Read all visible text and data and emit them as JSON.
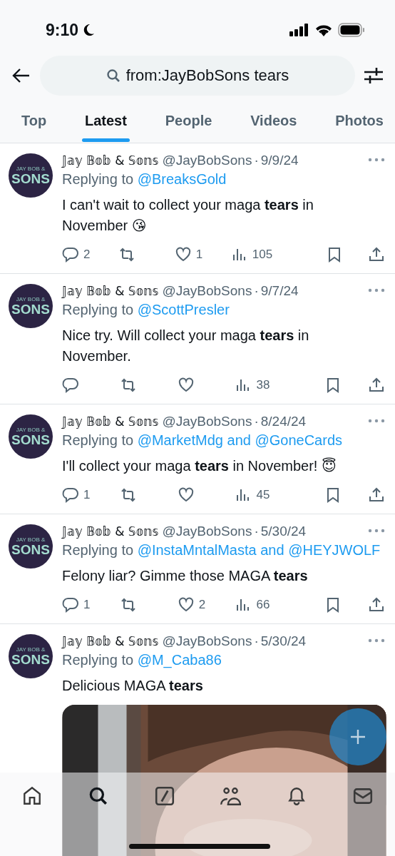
{
  "status_bar": {
    "time": "9:10"
  },
  "search": {
    "value": "from:JayBobSons tears"
  },
  "tabs": [
    {
      "label": "Top",
      "selected": false
    },
    {
      "label": "Latest",
      "selected": true
    },
    {
      "label": "People",
      "selected": false
    },
    {
      "label": "Videos",
      "selected": false
    },
    {
      "label": "Photos",
      "selected": false
    }
  ],
  "separator": "·",
  "tweets": [
    {
      "avatar": {
        "line_1": "JAY BOB &",
        "line_2": "SONS"
      },
      "name": "𝕁𝕒𝕪 𝔹𝕠𝕓 & 𝕊𝕠𝕟𝕤",
      "handle": "@JayBobSons",
      "date": "9/9/24",
      "replying_label": "Replying to",
      "replying_to": "@BreaksGold",
      "text": "I can't wait to collect your maga **tears** in November 😘",
      "actions": [
        {
          "kind": "reply",
          "count": "2"
        },
        {
          "kind": "retweet"
        },
        {
          "kind": "like",
          "count": "1"
        },
        {
          "kind": "views",
          "count": "105"
        },
        {
          "kind": "bookmark"
        },
        {
          "kind": "share"
        }
      ]
    },
    {
      "avatar": {
        "line_1": "JAY BOB &",
        "line_2": "SONS"
      },
      "name": "𝕁𝕒𝕪 𝔹𝕠𝕓 & 𝕊𝕠𝕟𝕤",
      "handle": "@JayBobSons",
      "date": "9/7/24",
      "replying_label": "Replying to",
      "replying_to": "@ScottPresler",
      "text": "Nice try. Will collect your maga **tears** in November.",
      "actions": [
        {
          "kind": "reply"
        },
        {
          "kind": "retweet"
        },
        {
          "kind": "like"
        },
        {
          "kind": "views",
          "count": "38"
        },
        {
          "kind": "bookmark"
        },
        {
          "kind": "share"
        }
      ]
    },
    {
      "avatar": {
        "line_1": "JAY BOB &",
        "line_2": "SONS"
      },
      "name": "𝕁𝕒𝕪 𝔹𝕠𝕓 & 𝕊𝕠𝕟𝕤",
      "handle": "@JayBobSons",
      "date": "8/24/24",
      "replying_label": "Replying to",
      "replying_to": "@MarketMdg and @GoneCards",
      "text": "I'll collect your maga **tears** in November! 😇",
      "actions": [
        {
          "kind": "reply",
          "count": "1"
        },
        {
          "kind": "retweet"
        },
        {
          "kind": "like"
        },
        {
          "kind": "views",
          "count": "45"
        },
        {
          "kind": "bookmark"
        },
        {
          "kind": "share"
        }
      ]
    },
    {
      "avatar": {
        "line_1": "JAY BOB &",
        "line_2": "SONS"
      },
      "name": "𝕁𝕒𝕪 𝔹𝕠𝕓 & 𝕊𝕠𝕟𝕤",
      "handle": "@JayBobSons",
      "date": "5/30/24",
      "replying_label": "Replying to",
      "replying_to": "@InstaMntalMasta and @HEYJWOLF",
      "text": "Felony liar? Gimme those MAGA **tears**",
      "actions": [
        {
          "kind": "reply",
          "count": "1"
        },
        {
          "kind": "retweet"
        },
        {
          "kind": "like",
          "count": "2"
        },
        {
          "kind": "views",
          "count": "66"
        },
        {
          "kind": "bookmark"
        },
        {
          "kind": "share"
        }
      ]
    },
    {
      "avatar": {
        "line_1": "JAY BOB &",
        "line_2": "SONS"
      },
      "name": "𝕁𝕒𝕪 𝔹𝕠𝕓 & 𝕊𝕠𝕟𝕤",
      "handle": "@JayBobSons",
      "date": "5/30/24",
      "replying_label": "Replying to",
      "replying_to": "@M_Caba86",
      "text": "Delicious MAGA **tears**"
    }
  ],
  "bottom_nav": [
    {
      "kind": "home",
      "selected": false
    },
    {
      "kind": "search",
      "selected": true
    },
    {
      "kind": "grok",
      "selected": false
    },
    {
      "kind": "communities",
      "selected": false
    },
    {
      "kind": "notifications",
      "selected": false
    },
    {
      "kind": "messages",
      "selected": false
    }
  ]
}
